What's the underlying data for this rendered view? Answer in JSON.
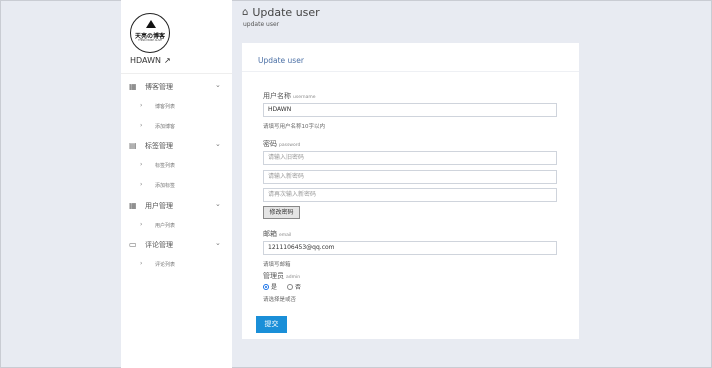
{
  "sidebar": {
    "logo_title": "天亮の博客",
    "logo_subtitle": "THINK MORE ALIVE",
    "username": "HDAWN",
    "groups": [
      {
        "label": "博客管理",
        "items": [
          "博客列表",
          "添加博客"
        ]
      },
      {
        "label": "标签管理",
        "items": [
          "标签列表",
          "添加标签"
        ]
      },
      {
        "label": "用户管理",
        "items": [
          "用户列表"
        ]
      },
      {
        "label": "评论管理",
        "items": [
          "评论列表"
        ]
      }
    ]
  },
  "header": {
    "title": "Update user",
    "subtitle": "update user"
  },
  "card": {
    "title": "Update user",
    "username": {
      "label": "用户名称",
      "label_en": "username",
      "value": "HDAWN",
      "help": "请填写用户名称10字以内"
    },
    "password": {
      "label": "密码",
      "label_en": "password",
      "placeholders": [
        "请输入旧密码",
        "请输入新密码",
        "请再次输入新密码"
      ],
      "change_button": "修改密码"
    },
    "email": {
      "label": "邮箱",
      "label_en": "email",
      "value": "1211106453@qq.com",
      "help": "请填写邮箱"
    },
    "admin": {
      "label": "管理员",
      "label_en": "admin",
      "option_yes": "是",
      "option_no": "否",
      "selected": "是",
      "help": "请选择是或否"
    },
    "submit": "提交"
  },
  "colors": {
    "accent": "#1a8fd8",
    "background": "#e8ebf2",
    "card_title": "#4a6fa5"
  }
}
